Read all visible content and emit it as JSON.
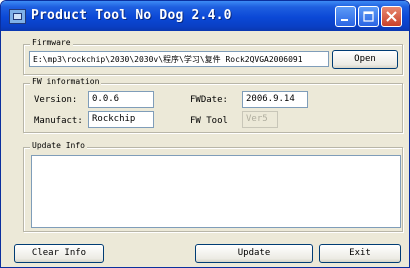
{
  "window": {
    "title": "Product Tool No Dog 2.4.0"
  },
  "firmware": {
    "legend": "Firmware",
    "path": "E:\\mp3\\rockchip\\2030\\2030v\\程序\\学习\\复件 Rock2QVGA2006091",
    "open_label": "Open"
  },
  "fw_info": {
    "legend": "FW information",
    "version_label": "Version:",
    "version_value": "0.0.6",
    "fwdate_label": "FWDate:",
    "fwdate_value": "2006.9.14",
    "manufact_label": "Manufact:",
    "manufact_value": "Rockchip",
    "fwtool_label": "FW Tool",
    "fwtool_value": "Ver5"
  },
  "update_info": {
    "legend": "Update Info",
    "text": ""
  },
  "buttons": {
    "clear_label": "Clear Info",
    "update_label": "Update",
    "exit_label": "Exit"
  }
}
